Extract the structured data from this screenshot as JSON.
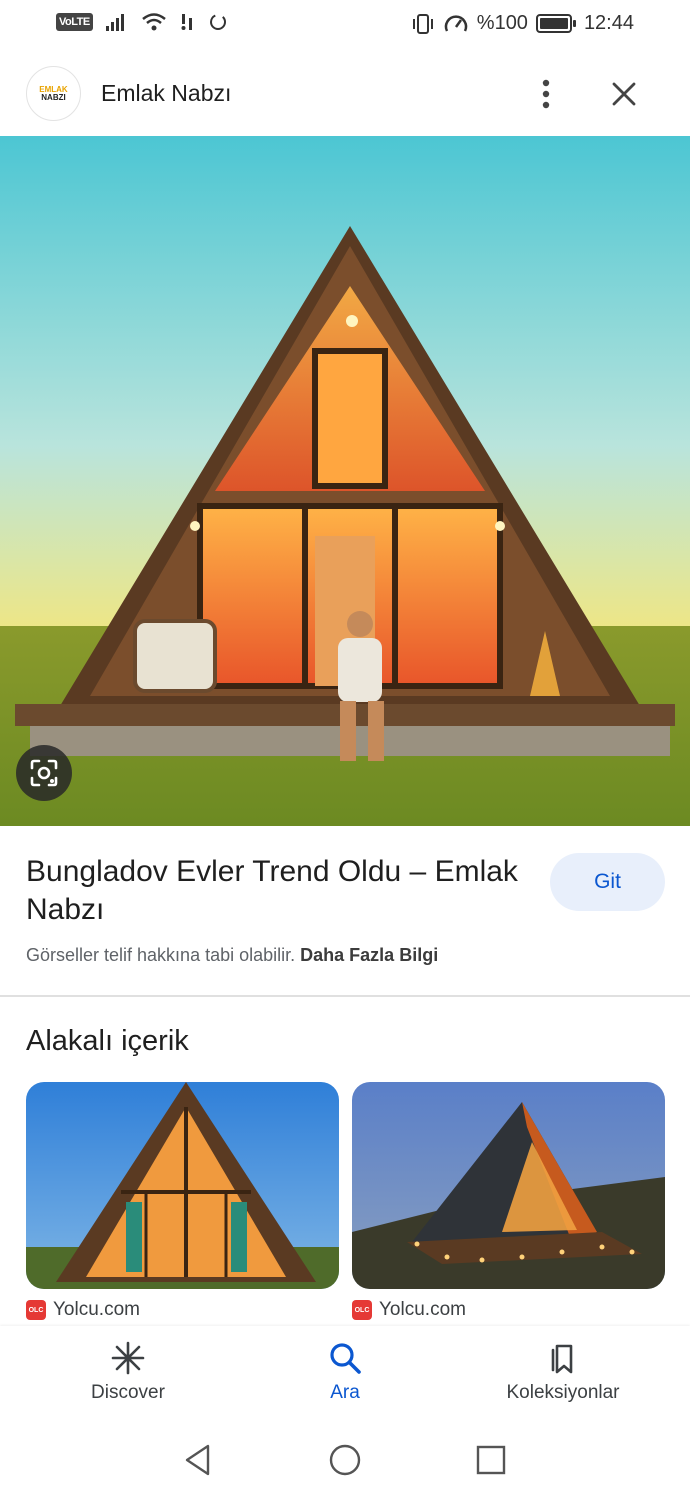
{
  "status_bar": {
    "volte": "VoLTE",
    "battery_text": "%100",
    "battery_level": 1.0,
    "time": "12:44",
    "icons": [
      "signal-icon",
      "wifi-icon",
      "data-activity-icon",
      "sync-icon",
      "vibrate-icon",
      "speed-icon",
      "battery-icon"
    ]
  },
  "header": {
    "logo_text_top": "EMLAK",
    "logo_text_bottom": "NABZI",
    "site_name": "Emlak Nabzı",
    "more_icon": "more-vert-icon",
    "close_icon": "close-icon"
  },
  "result": {
    "title": "Bungladov Evler Trend Oldu – Emlak Nabzı",
    "visit_label": "Git",
    "copyright_text": "Görseller telif hakkına tabi olabilir.",
    "learn_more_label": "Daha Fazla Bilgi",
    "lens_icon": "google-lens-icon"
  },
  "related": {
    "heading": "Alakalı içerik",
    "items": [
      {
        "source": "Yolcu.com",
        "favicon_text": "OLC"
      },
      {
        "source": "Yolcu.com",
        "favicon_text": "OLC"
      }
    ]
  },
  "bottom_nav": {
    "items": [
      {
        "label": "Discover",
        "icon": "asterisk-icon",
        "active": false
      },
      {
        "label": "Ara",
        "icon": "search-icon",
        "active": true
      },
      {
        "label": "Koleksiyonlar",
        "icon": "collections-icon",
        "active": false
      }
    ],
    "active_color": "#0b57d0"
  },
  "system_nav": {
    "icons": [
      "back-icon",
      "home-icon",
      "recents-icon"
    ]
  }
}
